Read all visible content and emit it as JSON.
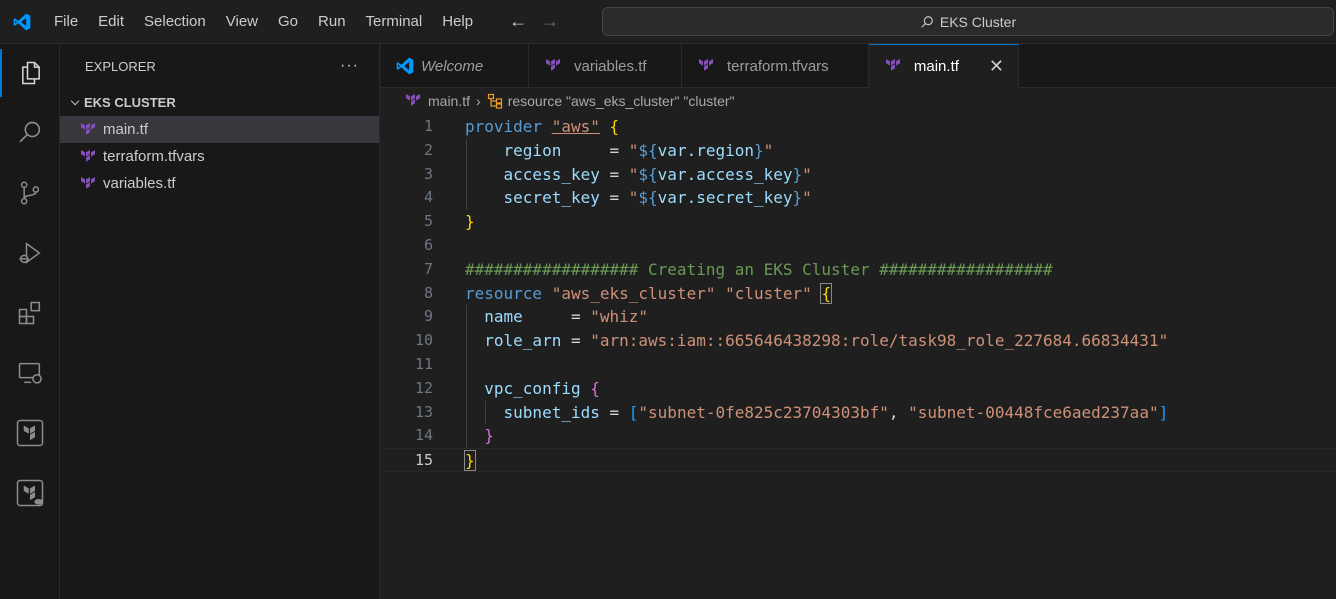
{
  "titlebar": {
    "menu": [
      "File",
      "Edit",
      "Selection",
      "View",
      "Go",
      "Run",
      "Terminal",
      "Help"
    ],
    "search_text": "EKS Cluster",
    "colors": {
      "logo": "#0098ff",
      "accent": "#0078d4"
    }
  },
  "activity": [
    "explorer-icon",
    "search-icon",
    "source-control-icon",
    "run-debug-icon",
    "extensions-icon",
    "remote-explorer-icon",
    "terraform-icon",
    "terraform-cloud-icon"
  ],
  "sidebar": {
    "title": "EXPLORER",
    "more": "···",
    "folder": "EKS CLUSTER",
    "files": [
      "main.tf",
      "terraform.tfvars",
      "variables.tf"
    ]
  },
  "tabs": [
    {
      "label": "Welcome",
      "icon": "vscode-icon"
    },
    {
      "label": "variables.tf",
      "icon": "terraform-icon"
    },
    {
      "label": "terraform.tfvars",
      "icon": "terraform-icon"
    },
    {
      "label": "main.tf",
      "icon": "terraform-icon",
      "active": true
    }
  ],
  "breadcrumb": {
    "file": "main.tf",
    "symbol": "resource \"aws_eks_cluster\" \"cluster\""
  },
  "editor": {
    "current_line": 15,
    "lines": [
      [
        [
          "kw",
          "provider"
        ],
        [
          "op",
          " "
        ],
        [
          "str ul",
          "\"aws\""
        ],
        [
          "op",
          " "
        ],
        [
          "brace1",
          "{"
        ]
      ],
      [
        [
          "op",
          "    "
        ],
        [
          "attr",
          "region"
        ],
        [
          "op",
          "     = "
        ],
        [
          "str",
          "\""
        ],
        [
          "tpl",
          "${"
        ],
        [
          "var",
          "var.region"
        ],
        [
          "tpl",
          "}"
        ],
        [
          "str",
          "\""
        ]
      ],
      [
        [
          "op",
          "    "
        ],
        [
          "attr",
          "access_key"
        ],
        [
          "op",
          " = "
        ],
        [
          "str",
          "\""
        ],
        [
          "tpl",
          "${"
        ],
        [
          "var",
          "var.access_key"
        ],
        [
          "tpl",
          "}"
        ],
        [
          "str",
          "\""
        ]
      ],
      [
        [
          "op",
          "    "
        ],
        [
          "attr",
          "secret_key"
        ],
        [
          "op",
          " = "
        ],
        [
          "str",
          "\""
        ],
        [
          "tpl",
          "${"
        ],
        [
          "var",
          "var.secret_key"
        ],
        [
          "tpl",
          "}"
        ],
        [
          "str",
          "\""
        ]
      ],
      [
        [
          "brace1",
          "}"
        ]
      ],
      [],
      [
        [
          "cm",
          "################## Creating an EKS Cluster ##################"
        ]
      ],
      [
        [
          "kw",
          "resource"
        ],
        [
          "op",
          " "
        ],
        [
          "str",
          "\"aws_eks_cluster\""
        ],
        [
          "op",
          " "
        ],
        [
          "str",
          "\"cluster\""
        ],
        [
          "op",
          " "
        ],
        [
          "brace1 boxed",
          "{"
        ]
      ],
      [
        [
          "op",
          "  "
        ],
        [
          "attr",
          "name"
        ],
        [
          "op",
          "     = "
        ],
        [
          "str",
          "\"whiz\""
        ]
      ],
      [
        [
          "op",
          "  "
        ],
        [
          "attr",
          "role_arn"
        ],
        [
          "op",
          " = "
        ],
        [
          "str",
          "\"arn:aws:iam::665646438298:role/task98_role_227684.66834431\""
        ]
      ],
      [],
      [
        [
          "op",
          "  "
        ],
        [
          "attr",
          "vpc_config"
        ],
        [
          "op",
          " "
        ],
        [
          "brace2",
          "{"
        ]
      ],
      [
        [
          "op",
          "    "
        ],
        [
          "attr",
          "subnet_ids"
        ],
        [
          "op",
          " = "
        ],
        [
          "brace3",
          "["
        ],
        [
          "str",
          "\"subnet-0fe825c23704303bf\""
        ],
        [
          "op",
          ", "
        ],
        [
          "str",
          "\"subnet-00448fce6aed237aa\""
        ],
        [
          "brace3",
          "]"
        ]
      ],
      [
        [
          "op",
          "  "
        ],
        [
          "brace2",
          "}"
        ]
      ],
      [
        [
          "brace1 boxed",
          "}"
        ]
      ]
    ]
  }
}
